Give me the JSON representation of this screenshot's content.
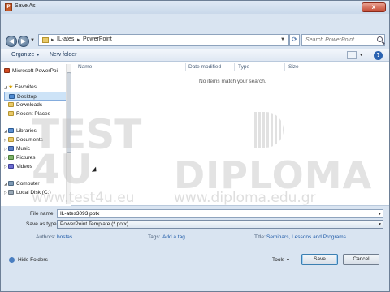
{
  "window": {
    "title": "Save As",
    "app_icon_letter": "P",
    "close_label": "x"
  },
  "address": {
    "crumbs": [
      "IL-ates",
      "PowerPoint"
    ],
    "separator": "▸"
  },
  "search": {
    "placeholder": "Search PowerPoint"
  },
  "toolbar": {
    "organize_label": "Organize",
    "new_folder_label": "New folder",
    "help_label": "?"
  },
  "sidebar": {
    "items": [
      {
        "label": "Microsoft PowerPoi",
        "icon": "powerpoint-icon"
      },
      {
        "label": "Favorites",
        "icon": "star-icon"
      },
      {
        "label": "Desktop",
        "icon": "desktop-icon",
        "selected": true
      },
      {
        "label": "Downloads",
        "icon": "folder-icon"
      },
      {
        "label": "Recent Places",
        "icon": "folder-icon"
      },
      {
        "label": "Libraries",
        "icon": "library-icon"
      },
      {
        "label": "Documents",
        "icon": "documents-icon"
      },
      {
        "label": "Music",
        "icon": "music-icon"
      },
      {
        "label": "Pictures",
        "icon": "pictures-icon"
      },
      {
        "label": "Videos",
        "icon": "videos-icon"
      },
      {
        "label": "Computer",
        "icon": "computer-icon"
      },
      {
        "label": "Local Disk (C:)",
        "icon": "disk-icon"
      }
    ]
  },
  "filelist": {
    "columns": [
      "Name",
      "Date modified",
      "Type",
      "Size"
    ],
    "empty_message": "No items match your search."
  },
  "form": {
    "filename_label": "File name:",
    "filename_value": "IL-ates3093.potx",
    "savetype_label": "Save as type:",
    "savetype_value": "PowerPoint Template (*.potx)",
    "authors_label": "Authors:",
    "authors_value": "bostas",
    "tags_label": "Tags:",
    "tags_value": "Add a tag",
    "title_label": "Title:",
    "title_value": "Seminars, Lessons and Programs"
  },
  "footer": {
    "hide_folders_label": "Hide Folders",
    "tools_label": "Tools",
    "save_label": "Save",
    "cancel_label": "Cancel"
  },
  "watermark": {
    "logo_line1": "TEST",
    "logo_line2": "4U",
    "brand": "DIPLOMA",
    "url1": "www.test4u.eu",
    "url2": "www.diploma.edu.gr"
  }
}
